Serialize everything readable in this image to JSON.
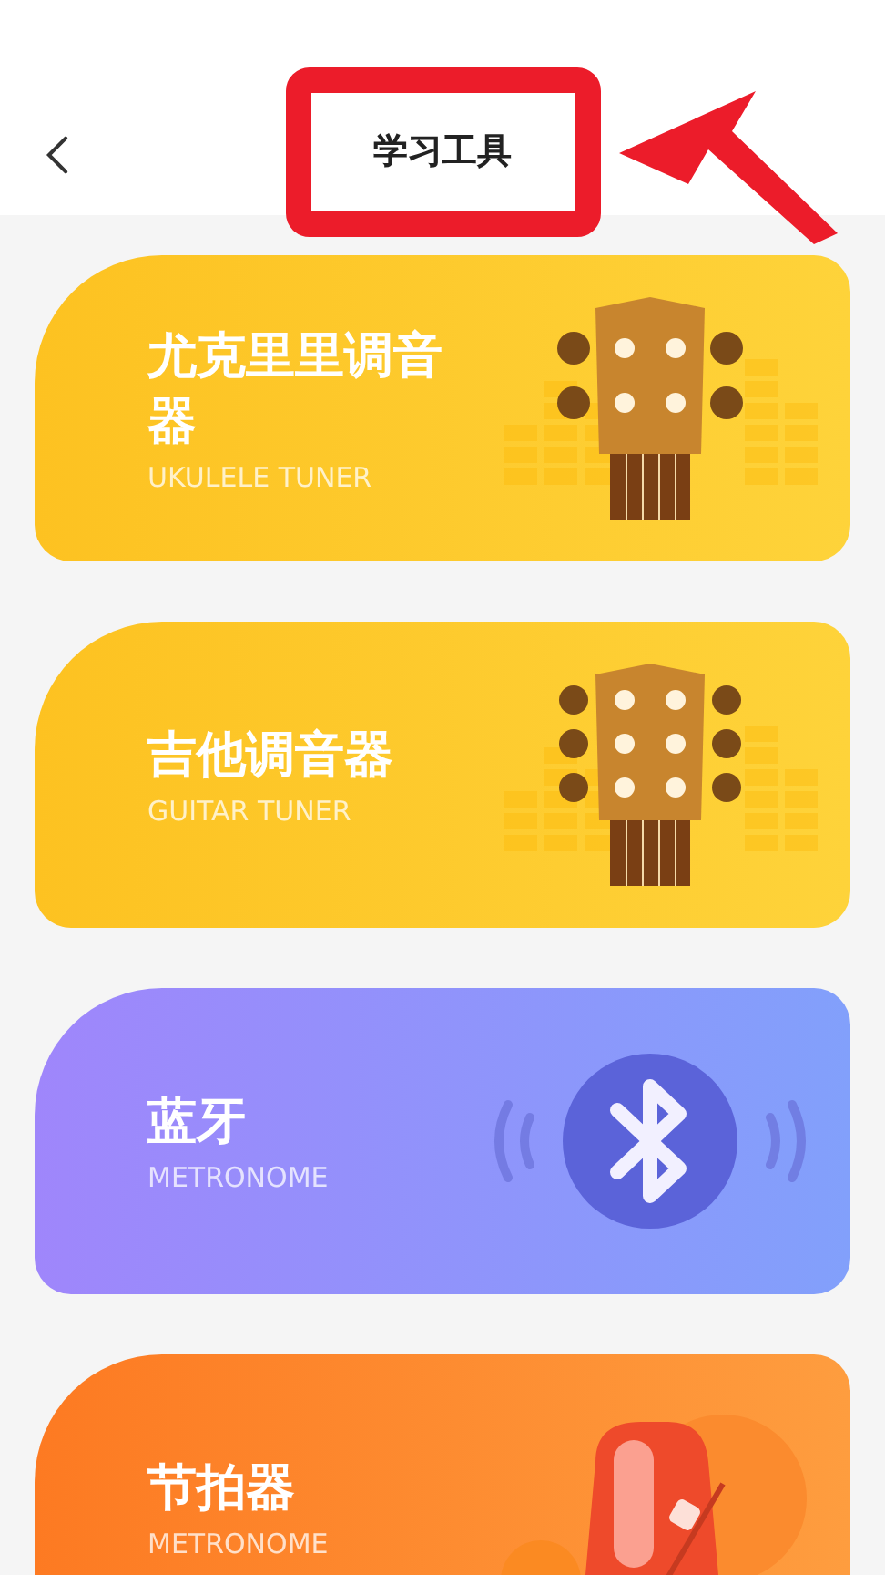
{
  "header": {
    "title": "学习工具"
  },
  "tools": [
    {
      "kind": "ukulele",
      "title": "尤克里里调音器",
      "subtitle": "UKULELE TUNER"
    },
    {
      "kind": "guitar",
      "title": "吉他调音器",
      "subtitle": "GUITAR TUNER"
    },
    {
      "kind": "bluetooth",
      "title": "蓝牙",
      "subtitle": "METRONOME"
    },
    {
      "kind": "metronome",
      "title": "节拍器",
      "subtitle": "METRONOME"
    }
  ]
}
